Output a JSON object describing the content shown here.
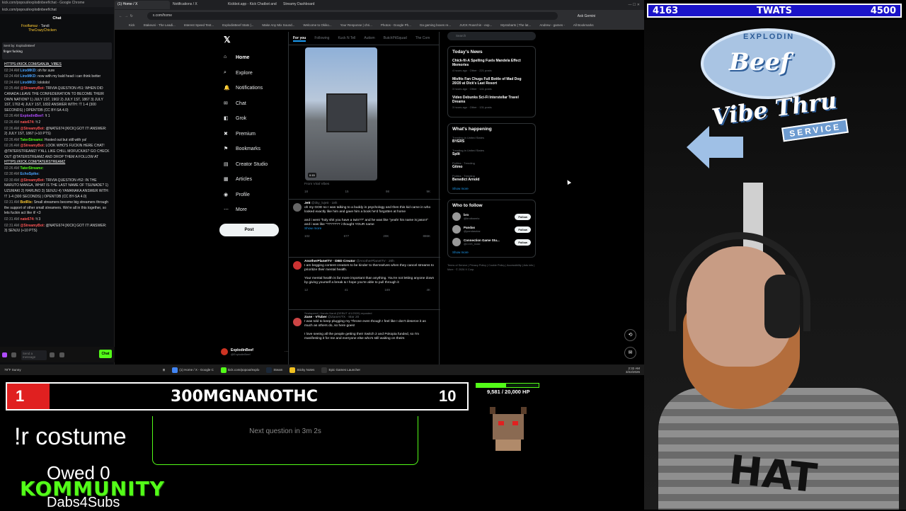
{
  "chat": {
    "url": "kick.com/popout/explodinbeef/chat - Google Chrome",
    "url2": "kick.com/popout/explodinbeef/chat",
    "header": "Chat",
    "top_user_1": "Foolfamaz",
    "top_user_2": "Tandi",
    "top_user_3": "TheCrazyChicken",
    "sent_by": "Sent by: ExplodinBeef",
    "sent_text": "finger fucking",
    "messages": [
      {
        "ts": "",
        "name": "",
        "text": "",
        "link": "HTTPS://KICK.COM/GANJA_VIBES",
        "color": "#fff"
      },
      {
        "ts": "02:24 AM",
        "name": "LinxMKD:",
        "text": "oh for sure",
        "link": "",
        "color": "#4aa3ff"
      },
      {
        "ts": "02:24 AM",
        "name": "LinxMKD:",
        "text": "now with my bald head i can think better",
        "link": "",
        "color": "#4aa3ff"
      },
      {
        "ts": "02:24 AM",
        "name": "LinxMKD:",
        "text": "lolololol",
        "link": "",
        "color": "#4aa3ff"
      },
      {
        "ts": "02:25 AM",
        "name": "@StreamyBot:",
        "text": "TRIVIA QUESTION #51: WHEN DID CANADA LEAVE THE CONFEDERATION TO BECOME THEIR OWN NATION? 1) JULY 1ST, 1902 2) JULY 1ST, 1867 3) JULY 1ST, 1763 4) JULY 1ST, 1832 ANSWER WITH: !T 1-4 (300 SECONDS) | OPENTDB (CC BY-SA 4.0)",
        "link": "",
        "color": "#ff5555"
      },
      {
        "ts": "02:26 AM",
        "name": "ExplodinBeef:",
        "text": "!t 1",
        "link": "",
        "color": "#b04cff"
      },
      {
        "ts": "02:26 AM",
        "name": "nate674:",
        "text": "!t 2",
        "link": "",
        "color": "#ff5555"
      },
      {
        "ts": "02:26 AM",
        "name": "@StreamyBot:",
        "text": "@NATE674 [KICK] GOT IT! ANSWER: 2) JULY 1ST, 1867 (+10 PTS)",
        "link": "",
        "color": "#ff5555"
      },
      {
        "ts": "02:26 AM",
        "name": "TaterStreamz:",
        "text": "Hosted out but still with ya!",
        "link": "",
        "color": "#53fc18"
      },
      {
        "ts": "02:26 AM",
        "name": "@StreamyBot:",
        "text": "LOOK WHO'S FUCKIN HERE CHAT! @TATERSTREAMZ! Y'ALL LIKE CHILL MOFUCKAS? GO CHECK OUT @TATERSTREAMZ AND DROP THEM A FOLLOW AT",
        "link": "HTTPS://KICK.COM/TATERSTREAMZ",
        "color": "#ff5555"
      },
      {
        "ts": "02:26 AM",
        "name": "TaterStreamz:",
        "text": "",
        "link": "",
        "color": "#53fc18"
      },
      {
        "ts": "02:30 AM",
        "name": "EchoSpike:",
        "text": "",
        "link": "",
        "color": "#4aa3ff"
      },
      {
        "ts": "02:30 AM",
        "name": "@StreamyBot:",
        "text": "TRIVIA QUESTION #52: IN THE NARUTO MANGA, WHAT IS THE LAST NAME OF TSUNADE? 1) UZUMAKI 2) HARUNO 3) SENJU 4) YAMANAKA ANSWER WITH: !T 1-4 (300 SECONDS) | OPENTDB (CC BY-SA 4.0)",
        "link": "",
        "color": "#ff5555"
      },
      {
        "ts": "02:31 AM",
        "name": "BotRix:",
        "text": "Small streamers become big streamers through the support of other small streamers. We're all in this together, so lets fuckin act like it! <3",
        "link": "",
        "color": "#ffcc33"
      },
      {
        "ts": "02:31 AM",
        "name": "nate674:",
        "text": "!t 3",
        "link": "",
        "color": "#ff5555"
      },
      {
        "ts": "02:31 AM",
        "name": "@StreamyBot:",
        "text": "@NATE674 [KICK] GOT IT! ANSWER: 3) SENJU (+10 PTS)",
        "link": "",
        "color": "#ff5555"
      }
    ],
    "input_placeholder": "Send a message",
    "send_label": "Chat"
  },
  "browser": {
    "tabs": [
      "(1) Home / X",
      "Notifications / X",
      "Kickbot.app - Kick Chatbot and",
      "Streamy Dashboard"
    ],
    "address": "x.com/home",
    "ask_label": "Ask Gemini",
    "bookmarks": [
      "Kick",
      "Stakeuni - The Leadi...",
      "Interest Speed Test...",
      "ExplodinBeef Stats |...",
      "Make Any Mix Sound...",
      "Welcome to Okiko...",
      "Your Response | chri...",
      "Photos - Google Ph...",
      "Ga gaming boxes re...",
      "JUCK Roarchin - exp...",
      "Mystobarts | The lat...",
      "Andrew - games -",
      "All Bookmarks"
    ]
  },
  "x": {
    "nav": [
      "Home",
      "Explore",
      "Notifications",
      "Chat",
      "Grok",
      "Premium",
      "Bookmarks",
      "Creator Studio",
      "Articles",
      "Profile",
      "More"
    ],
    "post_label": "Post",
    "account_name": "ExplodinBeef",
    "account_handle": "@ExplodinBeef",
    "feed_tabs": [
      "For you",
      "Following",
      "Kuck N Tell",
      "Autism",
      "ButchPitSquad",
      "The Com"
    ],
    "video_time": "0:15",
    "video_from": "From Viral Vibes",
    "tweet1_actions": [
      "18",
      "15",
      "98",
      "9K"
    ],
    "tweet2": {
      "name": "Jett",
      "handle": "@iiky_lvjett · 18h",
      "text": "oh my GOD so I was talking to a buddy in psychology and then this kid came in who looked exactly like him and gave him a book he'd forgotten at home\n\nand i went \"holy shit you have a twin??\" and he was like \"yeah! his name is jason!\" and i was like \"??????? i thought YOUR name",
      "more": "Show more",
      "actions": [
        "102",
        "677",
        "20K",
        "886K"
      ]
    },
    "tweet3": {
      "name": "AnotherPlanetTV · DBD Creator",
      "handle": "@AnotherPlanetTV · 20h",
      "text": "I am begging content creators to be kinder to themselves when they cancel streams to prioritize their mental health.\n\nYour mental health is far more important than anything. You're not letting anyone down by giving yourself a break & I hope you're able to pull through it",
      "actions": [
        "12",
        "41",
        "169",
        "4K"
      ]
    },
    "tweet4": {
      "repost": "Sealapeed | Hando Nardi (DEBUT 4/1/2026) reposted",
      "name": "Zane · VTuber",
      "handle": "@ZaneVTX · Mar 20",
      "text": "I was told to keep plugging my Throne even though I feel like I don't deserve it as much as others do, so here goes!\n\nI love seeing all the people getting their Switch 2 and Pokopia funded, so I'm manifesting it for me and everyone else who's still waiting on theirs"
    },
    "search_placeholder": "Search",
    "news_title": "Today's News",
    "news": [
      {
        "title": "Chick-fil-A Spelling Fuels Mandela Effect Memories",
        "meta": "4 hours ago · Other · 221 posts"
      },
      {
        "title": "Misfits Fan Chugs Full Bottle of Mad Dog 20/20 at Dick's Last Resort",
        "meta": "3 hours ago · Other · 141 posts"
      },
      {
        "title": "Video Debunks Sci-Fi Interstellar Travel Dreams",
        "meta": "3 hours ago · Other · 131 posts"
      }
    ],
    "happening_title": "What's happening",
    "trends": [
      {
        "cat": "Trending in United States",
        "name": "BYERS"
      },
      {
        "cat": "Trending in United States",
        "name": "Split"
      },
      {
        "cat": "Politics · Trending",
        "name": "Gitmo"
      },
      {
        "cat": "Politics · Trending",
        "name": "Benedict Arnold"
      }
    ],
    "show_more": "Show more",
    "wtf_title": "Who to follow",
    "follow_suggestions": [
      {
        "name": "bro",
        "handle": "@brottweetz"
      },
      {
        "name": "Pandas",
        "handle": "@pandasdaz"
      },
      {
        "name": "Connection Game Stu...",
        "handle": "@CGS_Indie"
      }
    ],
    "follow_label": "Follow",
    "footer": "Terms of Service | Privacy Policy | Cookie Policy | Accessibility | Ads info | More · © 2026 X Corp."
  },
  "taskbar": {
    "weather": "79°F Sunny",
    "items": [
      "(1) Home / X - Google C",
      "kick.com/popout/explo",
      "Steam",
      "Sticky Notes",
      "Epic Games Launcher"
    ],
    "time": "2:32 AM",
    "date": "3/22/2026"
  },
  "overlay": {
    "score_left": "4163",
    "score_title": "TWATS",
    "score_right": "4500",
    "sign_explodin": "EXPLODIN",
    "sign_beef": "Beef",
    "sign_vibe": "Vibe Thru",
    "sign_service": "SERVICE",
    "shirt_text": "HAT",
    "trivia_rank": "1",
    "trivia_name": "300MGNANOTHC",
    "trivia_score": "10",
    "next_question": "Next question in 3m 2s",
    "command": "!r costume",
    "owed": "Owed 0",
    "kommunity": "OMMUNITY",
    "dabs": "Dabs4Subs",
    "hp_text": "9,581 / 20,000 HP",
    "hp_fraction": 0.479
  },
  "colors": {
    "kick_green": "#53fc18",
    "x_blue": "#1d9bf0",
    "score_blue": "#1a13c8",
    "trivia_red": "#e02020"
  }
}
